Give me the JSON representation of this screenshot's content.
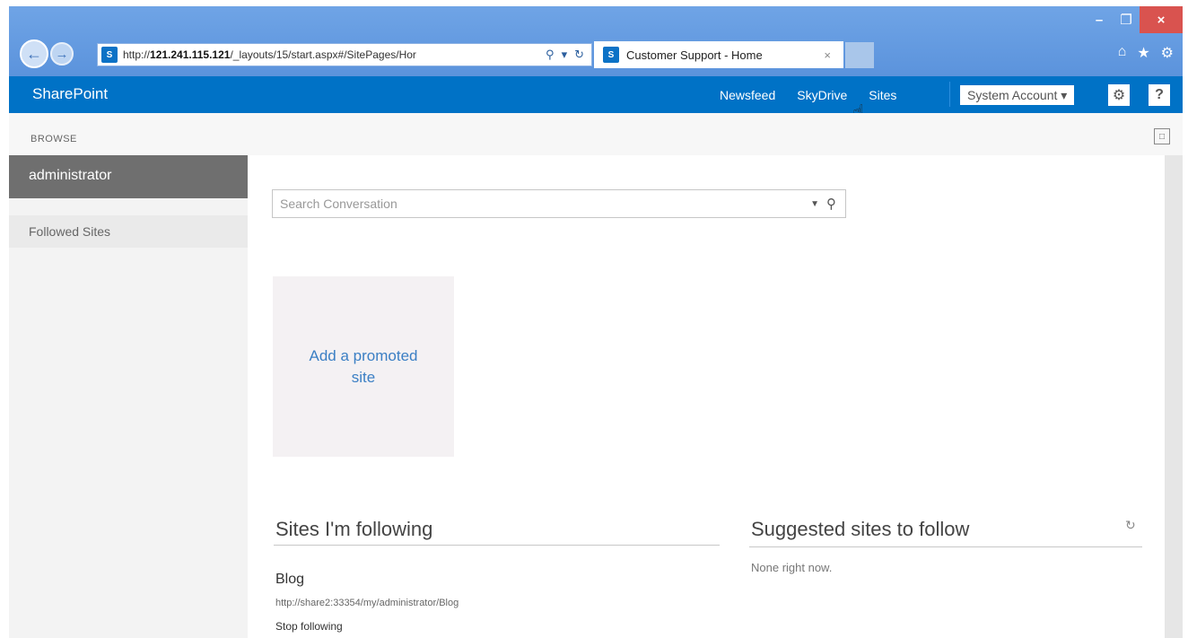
{
  "browser": {
    "url_prefix": "http://",
    "url_host": "121.241.115.121",
    "url_path": "/_layouts/15/start.aspx#/SitePages/Hor",
    "tab_title": "Customer Support - Home",
    "tab_close": "×",
    "site_icon_text": "S",
    "window": {
      "minimize": "–",
      "restore": "❐",
      "close": "×"
    }
  },
  "suitebar": {
    "brand": "SharePoint",
    "links": [
      "Newsfeed",
      "SkyDrive",
      "Sites"
    ],
    "account": "System Account ▾",
    "settings_icon": "⚙",
    "help_icon": "?"
  },
  "ribbon": {
    "browse_label": "BROWSE"
  },
  "leftnav": {
    "user": "administrator",
    "followed_sites": "Followed Sites"
  },
  "search": {
    "placeholder": "Search Conversation"
  },
  "promoted_tile": {
    "label": "Add a promoted site"
  },
  "following": {
    "title": "Sites I'm following",
    "items": [
      {
        "name": "Blog",
        "url": "http://share2:33354/my/administrator/Blog",
        "action": "Stop following"
      }
    ]
  },
  "suggested": {
    "title": "Suggested sites to follow",
    "empty_text": "None right now."
  },
  "colors": {
    "suite_bar": "#0072c6",
    "chrome": "#5b93dc",
    "close_button": "#d9534f",
    "left_nav_user": "#6f6f6f",
    "link": "#3b7fc4"
  },
  "icons": [
    "back-icon",
    "forward-icon",
    "sharepoint-logo-icon",
    "search-icon",
    "dropdown-icon",
    "refresh-icon",
    "home-icon",
    "star-icon",
    "gear-icon",
    "help-icon",
    "focus-on-content-icon",
    "hand-cursor-icon"
  ]
}
